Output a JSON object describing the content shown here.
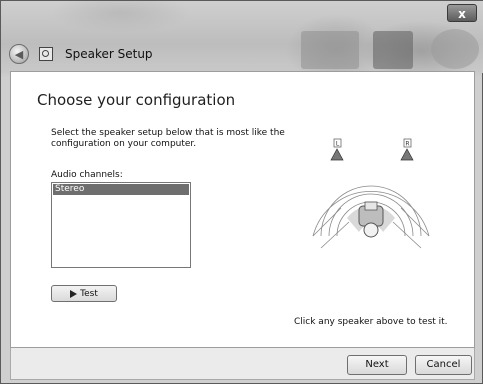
{
  "window": {
    "close_label": "x",
    "title": "Speaker Setup"
  },
  "main": {
    "heading": "Choose your configuration",
    "description": "Select the speaker setup below that is most like the configuration on your computer.",
    "channels_label": "Audio channels:",
    "channels": [
      {
        "label": "Stereo",
        "selected": true
      }
    ],
    "test_label": "Test",
    "hint": "Click any speaker above to test it.",
    "speaker_left_label": "L",
    "speaker_right_label": "R"
  },
  "footer": {
    "next_label": "Next",
    "cancel_label": "Cancel"
  },
  "icons": {
    "back": "back-arrow-icon",
    "wizard": "speaker-setup-icon",
    "test": "play-icon"
  }
}
